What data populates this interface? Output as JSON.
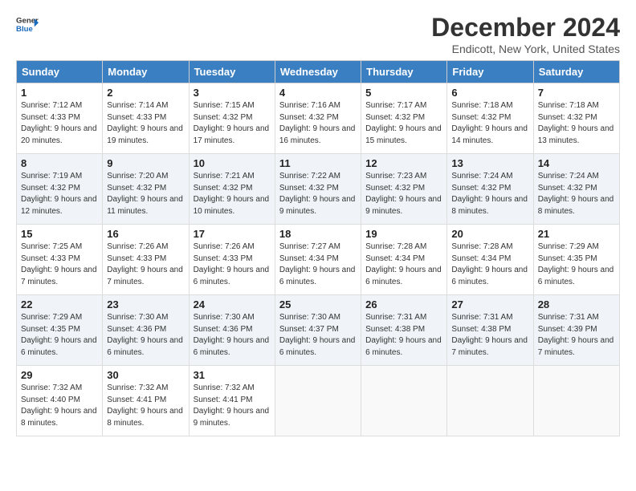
{
  "header": {
    "logo_line1": "General",
    "logo_line2": "Blue",
    "title": "December 2024",
    "subtitle": "Endicott, New York, United States"
  },
  "days_of_week": [
    "Sunday",
    "Monday",
    "Tuesday",
    "Wednesday",
    "Thursday",
    "Friday",
    "Saturday"
  ],
  "weeks": [
    [
      {
        "day": "1",
        "sunrise": "7:12 AM",
        "sunset": "4:33 PM",
        "daylight": "9 hours and 20 minutes."
      },
      {
        "day": "2",
        "sunrise": "7:14 AM",
        "sunset": "4:33 PM",
        "daylight": "9 hours and 19 minutes."
      },
      {
        "day": "3",
        "sunrise": "7:15 AM",
        "sunset": "4:32 PM",
        "daylight": "9 hours and 17 minutes."
      },
      {
        "day": "4",
        "sunrise": "7:16 AM",
        "sunset": "4:32 PM",
        "daylight": "9 hours and 16 minutes."
      },
      {
        "day": "5",
        "sunrise": "7:17 AM",
        "sunset": "4:32 PM",
        "daylight": "9 hours and 15 minutes."
      },
      {
        "day": "6",
        "sunrise": "7:18 AM",
        "sunset": "4:32 PM",
        "daylight": "9 hours and 14 minutes."
      },
      {
        "day": "7",
        "sunrise": "7:18 AM",
        "sunset": "4:32 PM",
        "daylight": "9 hours and 13 minutes."
      }
    ],
    [
      {
        "day": "8",
        "sunrise": "7:19 AM",
        "sunset": "4:32 PM",
        "daylight": "9 hours and 12 minutes."
      },
      {
        "day": "9",
        "sunrise": "7:20 AM",
        "sunset": "4:32 PM",
        "daylight": "9 hours and 11 minutes."
      },
      {
        "day": "10",
        "sunrise": "7:21 AM",
        "sunset": "4:32 PM",
        "daylight": "9 hours and 10 minutes."
      },
      {
        "day": "11",
        "sunrise": "7:22 AM",
        "sunset": "4:32 PM",
        "daylight": "9 hours and 9 minutes."
      },
      {
        "day": "12",
        "sunrise": "7:23 AM",
        "sunset": "4:32 PM",
        "daylight": "9 hours and 9 minutes."
      },
      {
        "day": "13",
        "sunrise": "7:24 AM",
        "sunset": "4:32 PM",
        "daylight": "9 hours and 8 minutes."
      },
      {
        "day": "14",
        "sunrise": "7:24 AM",
        "sunset": "4:32 PM",
        "daylight": "9 hours and 8 minutes."
      }
    ],
    [
      {
        "day": "15",
        "sunrise": "7:25 AM",
        "sunset": "4:33 PM",
        "daylight": "9 hours and 7 minutes."
      },
      {
        "day": "16",
        "sunrise": "7:26 AM",
        "sunset": "4:33 PM",
        "daylight": "9 hours and 7 minutes."
      },
      {
        "day": "17",
        "sunrise": "7:26 AM",
        "sunset": "4:33 PM",
        "daylight": "9 hours and 6 minutes."
      },
      {
        "day": "18",
        "sunrise": "7:27 AM",
        "sunset": "4:34 PM",
        "daylight": "9 hours and 6 minutes."
      },
      {
        "day": "19",
        "sunrise": "7:28 AM",
        "sunset": "4:34 PM",
        "daylight": "9 hours and 6 minutes."
      },
      {
        "day": "20",
        "sunrise": "7:28 AM",
        "sunset": "4:34 PM",
        "daylight": "9 hours and 6 minutes."
      },
      {
        "day": "21",
        "sunrise": "7:29 AM",
        "sunset": "4:35 PM",
        "daylight": "9 hours and 6 minutes."
      }
    ],
    [
      {
        "day": "22",
        "sunrise": "7:29 AM",
        "sunset": "4:35 PM",
        "daylight": "9 hours and 6 minutes."
      },
      {
        "day": "23",
        "sunrise": "7:30 AM",
        "sunset": "4:36 PM",
        "daylight": "9 hours and 6 minutes."
      },
      {
        "day": "24",
        "sunrise": "7:30 AM",
        "sunset": "4:36 PM",
        "daylight": "9 hours and 6 minutes."
      },
      {
        "day": "25",
        "sunrise": "7:30 AM",
        "sunset": "4:37 PM",
        "daylight": "9 hours and 6 minutes."
      },
      {
        "day": "26",
        "sunrise": "7:31 AM",
        "sunset": "4:38 PM",
        "daylight": "9 hours and 6 minutes."
      },
      {
        "day": "27",
        "sunrise": "7:31 AM",
        "sunset": "4:38 PM",
        "daylight": "9 hours and 7 minutes."
      },
      {
        "day": "28",
        "sunrise": "7:31 AM",
        "sunset": "4:39 PM",
        "daylight": "9 hours and 7 minutes."
      }
    ],
    [
      {
        "day": "29",
        "sunrise": "7:32 AM",
        "sunset": "4:40 PM",
        "daylight": "9 hours and 8 minutes."
      },
      {
        "day": "30",
        "sunrise": "7:32 AM",
        "sunset": "4:41 PM",
        "daylight": "9 hours and 8 minutes."
      },
      {
        "day": "31",
        "sunrise": "7:32 AM",
        "sunset": "4:41 PM",
        "daylight": "9 hours and 9 minutes."
      },
      null,
      null,
      null,
      null
    ]
  ]
}
